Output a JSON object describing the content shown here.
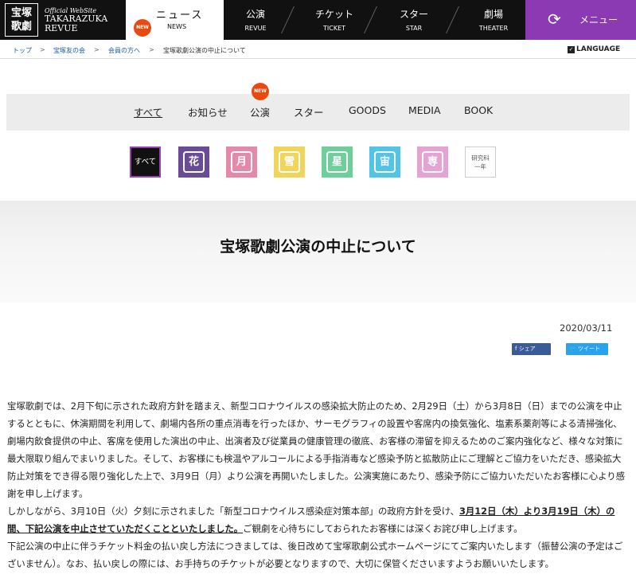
{
  "header": {
    "logo_mark": "宝塚\n歌劇",
    "logo_small": "Official WebSite",
    "logo_line1": "TAKARAZUKA",
    "logo_line2": "REVUE",
    "new_badge": "NEW",
    "nav": [
      {
        "ja": "ニュース",
        "en": "NEWS"
      },
      {
        "ja": "公演",
        "en": "REVUE"
      },
      {
        "ja": "チケット",
        "en": "TICKET"
      },
      {
        "ja": "スター",
        "en": "STAR"
      },
      {
        "ja": "劇場",
        "en": "THEATER"
      }
    ],
    "menu_label": "メニュー",
    "menu_icon": "refresh-icon"
  },
  "breadcrumb": {
    "items": [
      "トップ",
      "宝塚友の会",
      "会員の方へ"
    ],
    "current": "宝塚歌劇公演の中止について",
    "language": "LANGUAGE"
  },
  "categories": {
    "items": [
      "すべて",
      "お知らせ",
      "公演",
      "スター",
      "GOODS",
      "MEDIA",
      "BOOK"
    ],
    "new_badge": "NEW"
  },
  "troupes": {
    "all_label": "すべて",
    "icons": [
      {
        "glyph": "花",
        "color": "#6a4b97"
      },
      {
        "glyph": "月",
        "color": "#e489a8"
      },
      {
        "glyph": "雪",
        "color": "#f1d45a"
      },
      {
        "glyph": "星",
        "color": "#6fcf9a"
      },
      {
        "glyph": "宙",
        "color": "#52c4e6"
      },
      {
        "glyph": "専",
        "color": "#e4a3d2"
      }
    ],
    "kenkyuka": "研究科\n一年"
  },
  "article": {
    "title": "宝塚歌劇公演の中止について",
    "date": "2020/03/11",
    "share_fb": "シェア",
    "share_tw": "ツイート",
    "para1": "宝塚歌劇では、2月下旬に示された政府方針を踏まえ、新型コロナウイルスの感染拡大防止のため、2月29日（土）から3月8日（日）までの公演を中止するとともに、休演期間を利用して、劇場内各所の重点消毒を行ったほか、サーモグラフィの設置や客席内の換気強化、塩素系薬剤等による清掃強化、劇場内飲食提供の中止、客席を使用した演出の中止、出演者及び従業員の健康管理の徹底、お客様の滞留を抑えるためのご案内強化など、様々な対策に最大限取り組んでまいりました。そして、お客様にも検温やアルコールによる手指消毒など感染予防と拡散防止にご理解とご協力をいただき、感染拡大防止対策をでき得る限り強化した上で、3月9日（月）より公演を再開いたしました。公演実施にあたり、感染予防にご協力いただいたお客様に心より感謝を申し上げます。",
    "para2_a": "しかしながら、3月10日（火）夕刻に示されました「新型コロナウイルス感染症対策本部」の政府方針を受け、",
    "para2_b": "3月12日（木）より3月19日（木）の間、下記公演を中止させていただくことといたしました。",
    "para2_c": "ご観劇を心待ちにしておられたお客様には深くお詫び申し上げます。",
    "para3": "下記公演の中止に伴うチケット料金の払い戻し方法につきましては、後日改めて宝塚歌劇公式ホームページにてご案内いたします（振替公演の予定はございません）。なお、払い戻しの際には、お手持ちのチケットが必要となりますので、大切に保管くださいますようお願いいたします。"
  }
}
